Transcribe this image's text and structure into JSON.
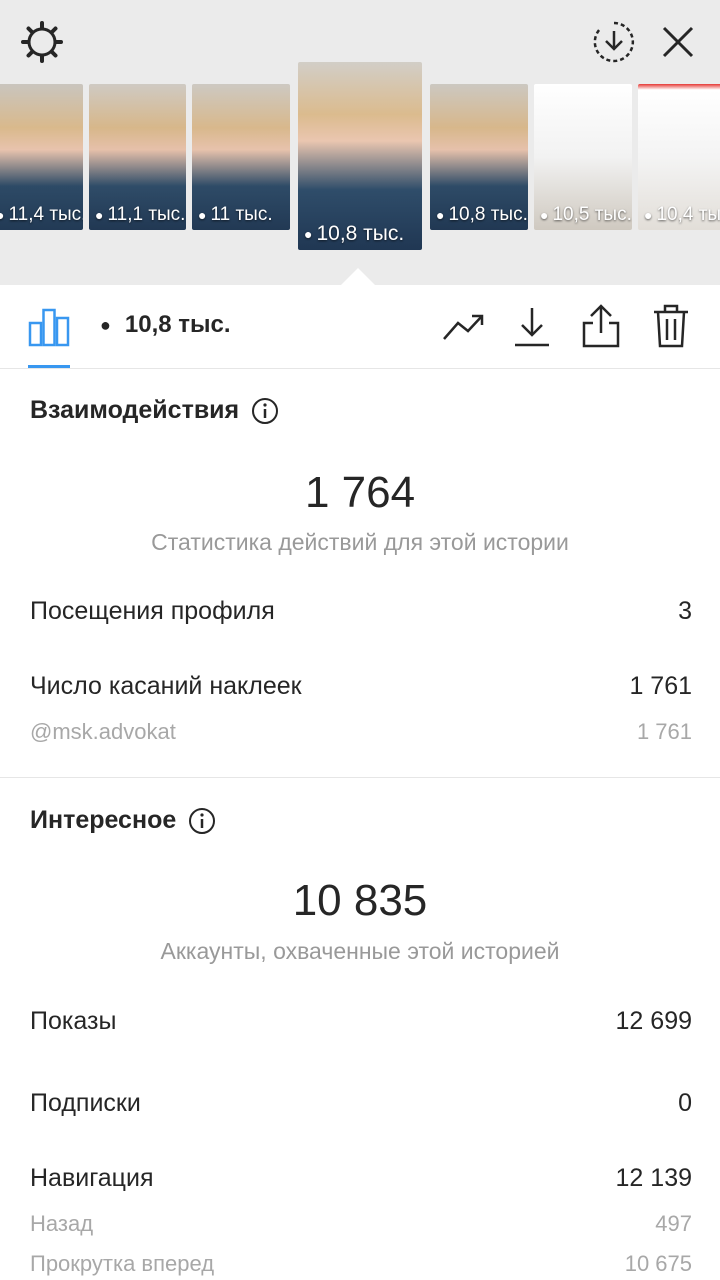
{
  "header": {
    "settings_icon": "gear-icon",
    "download_icon": "download-circle-icon",
    "close_icon": "close-icon"
  },
  "thumbnails": [
    {
      "views": "11,4 тыс."
    },
    {
      "views": "11,1 тыс."
    },
    {
      "views": "11 тыс."
    },
    {
      "views": "10,8 тыс."
    },
    {
      "views": "10,8 тыс."
    },
    {
      "views": "10,5 тыс."
    },
    {
      "views": "10,4 тыс."
    }
  ],
  "toolbar": {
    "views": "10,8 тыс.",
    "accent_color": "#3897f0"
  },
  "interactions": {
    "title": "Взаимодействия",
    "total": "1 764",
    "subtitle": "Статистика действий для этой истории",
    "rows": [
      {
        "label": "Посещения профиля",
        "value": "3"
      },
      {
        "label": "Число касаний наклеек",
        "value": "1 761"
      }
    ],
    "sub_rows": [
      {
        "label": "@msk.advokat",
        "value": "1 761"
      }
    ]
  },
  "discovery": {
    "title": "Интересное",
    "total": "10 835",
    "subtitle": "Аккаунты, охваченные этой историей",
    "rows": [
      {
        "label": "Показы",
        "value": "12 699"
      },
      {
        "label": "Подписки",
        "value": "0"
      },
      {
        "label": "Навигация",
        "value": "12 139"
      }
    ],
    "sub_rows": [
      {
        "label": "Назад",
        "value": "497"
      },
      {
        "label": "Прокрутка вперед",
        "value": "10 675"
      }
    ]
  }
}
